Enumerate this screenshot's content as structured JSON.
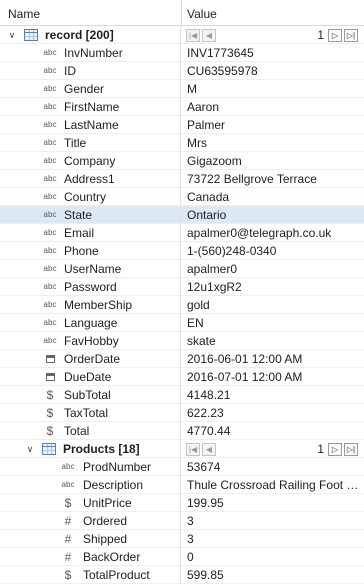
{
  "header": {
    "name_label": "Name",
    "value_label": "Value"
  },
  "record": {
    "label": "record [200]",
    "page": "1",
    "nav_first": "|◀",
    "nav_prev": "◀",
    "nav_next": "▷",
    "nav_last": "▷|",
    "fields": [
      {
        "icon": "abc",
        "name": "InvNumber",
        "value": "INV1773645"
      },
      {
        "icon": "abc",
        "name": "ID",
        "value": "CU63595978"
      },
      {
        "icon": "abc",
        "name": "Gender",
        "value": "M"
      },
      {
        "icon": "abc",
        "name": "FirstName",
        "value": "Aaron"
      },
      {
        "icon": "abc",
        "name": "LastName",
        "value": "Palmer"
      },
      {
        "icon": "abc",
        "name": "Title",
        "value": "Mrs"
      },
      {
        "icon": "abc",
        "name": "Company",
        "value": "Gigazoom"
      },
      {
        "icon": "abc",
        "name": "Address1",
        "value": "73722 Bellgrove Terrace"
      },
      {
        "icon": "abc",
        "name": "Country",
        "value": "Canada"
      },
      {
        "icon": "abc",
        "name": "State",
        "value": "Ontario",
        "selected": true
      },
      {
        "icon": "abc",
        "name": "Email",
        "value": "apalmer0@telegraph.co.uk"
      },
      {
        "icon": "abc",
        "name": "Phone",
        "value": "1-(560)248-0340"
      },
      {
        "icon": "abc",
        "name": "UserName",
        "value": "apalmer0"
      },
      {
        "icon": "abc",
        "name": "Password",
        "value": "12u1xgR2"
      },
      {
        "icon": "abc",
        "name": "MemberShip",
        "value": "gold"
      },
      {
        "icon": "abc",
        "name": "Language",
        "value": "EN"
      },
      {
        "icon": "abc",
        "name": "FavHobby",
        "value": "skate"
      },
      {
        "icon": "calendar",
        "name": "OrderDate",
        "value": "2016-06-01 12:00 AM"
      },
      {
        "icon": "calendar",
        "name": "DueDate",
        "value": "2016-07-01 12:00 AM"
      },
      {
        "icon": "$",
        "name": "SubTotal",
        "value": "4148.21"
      },
      {
        "icon": "$",
        "name": "TaxTotal",
        "value": "622.23"
      },
      {
        "icon": "$",
        "name": "Total",
        "value": "4770.44"
      }
    ]
  },
  "products": {
    "label": "Products [18]",
    "page": "1",
    "nav_first": "|◀",
    "nav_prev": "◀",
    "nav_next": "▷",
    "nav_last": "▷|",
    "fields": [
      {
        "icon": "abc",
        "name": "ProdNumber",
        "value": "53674"
      },
      {
        "icon": "abc",
        "name": "Description",
        "value": "Thule Crossroad Railing Foot P..."
      },
      {
        "icon": "$",
        "name": "UnitPrice",
        "value": "199.95"
      },
      {
        "icon": "#",
        "name": "Ordered",
        "value": "3"
      },
      {
        "icon": "#",
        "name": "Shipped",
        "value": "3"
      },
      {
        "icon": "#",
        "name": "BackOrder",
        "value": "0"
      },
      {
        "icon": "$",
        "name": "TotalProduct",
        "value": "599.85"
      }
    ]
  },
  "colors": {
    "selected_row": "#dde8f5",
    "grid_line": "#eeeeee"
  }
}
